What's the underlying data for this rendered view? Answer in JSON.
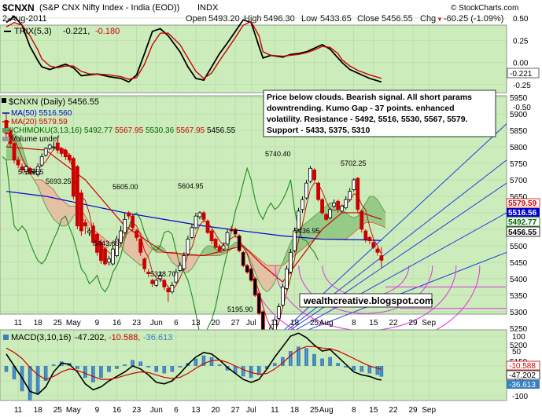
{
  "header": {
    "symbol": "$CNXN",
    "name": "(S&P CNX Nifty Index - India (EOD))",
    "exchange": "INDX",
    "brand": "© StockCharts.com",
    "date": "2-Aug-2011",
    "open_label": "Open",
    "open": "5493.20",
    "high_label": "High",
    "high": "5496.30",
    "low_label": "Low",
    "low": "5433.65",
    "close_label": "Close",
    "close": "5456.55",
    "chg_label": "Chg",
    "chg": "-60.25 (-1.09%)",
    "chg_arrow": "▼"
  },
  "trix_panel": {
    "legend_name": "TRIX(5,3)",
    "legend_v1": "-0.221,",
    "legend_v2": "-0.180",
    "tag": "-0.221",
    "ticks": [
      "0.50",
      "0.25",
      "0.00",
      "-0.25",
      "-0.50"
    ],
    "colors": {
      "trix": "#000000",
      "signal": "#cc0000"
    }
  },
  "price_panel": {
    "legend_symbol": "$CNXN (Daily) 5456.55",
    "legend_ma50": "MA(50) 5516.560",
    "legend_ma20": "MA(20) 5579.59",
    "legend_ichimoku": "ICHIMOKU(3,13,16)",
    "legend_ichimoku_vals": [
      "5492.77",
      "5567.95",
      "5530.36",
      "5567.95",
      "5456.55"
    ],
    "legend_volume": "Volume undef",
    "ticks": [
      "5950",
      "5900",
      "5850",
      "5800",
      "5750",
      "5700",
      "5650",
      "5600",
      "5550",
      "5500",
      "5450",
      "5400",
      "5350",
      "5300",
      "5250",
      "5200",
      "5150"
    ],
    "annotations": [
      "5735.55",
      "5693.25",
      "5605.00",
      "5604.95",
      "5443.65",
      "5328.70",
      "5195.90",
      "5740.40",
      "5702.25",
      "5436.95"
    ],
    "callout": [
      "Price below clouds. Bearish signal. All short params",
      "downtrending. Kumo Gap - 37 points. enhanced",
      "volatility. Resistance - 5492, 5516, 5530, 5567, 5579.",
      "Support - 5433, 5375, 5310"
    ],
    "watermark": "wealthcreative.blogspot.com",
    "tags": [
      "5579.59",
      "5516.56",
      "5492.77",
      "5456.55"
    ]
  },
  "macd_panel": {
    "legend_name": "MACD(3,10,16)",
    "legend_v1": "-47.202,",
    "legend_v2": "-10.588,",
    "legend_v3": "-36.613",
    "ticks": [
      "100",
      "50",
      "0",
      "-50",
      "-100"
    ],
    "tags": [
      "-10.588",
      "-47.202",
      "-36.613"
    ]
  },
  "x_axis": {
    "ticks": [
      "11",
      "18",
      "25",
      "May",
      "9",
      "16",
      "23",
      "Jun",
      "6",
      "13",
      "20",
      "27",
      "Jul",
      "11",
      "18",
      "25",
      "Aug",
      "8",
      "15",
      "22",
      "29",
      "Sep"
    ]
  },
  "chart_data": [
    {
      "type": "line",
      "title": "TRIX(5,3)",
      "ylim": [
        -0.6,
        0.65
      ],
      "series": [
        {
          "name": "TRIX(5,3)",
          "color": "#000000",
          "x": [
            0,
            2,
            4,
            6,
            8,
            9,
            11,
            13,
            15,
            17,
            19,
            21,
            23,
            26,
            29,
            31,
            33,
            35,
            37,
            39,
            41,
            44,
            46,
            48,
            50,
            52,
            54,
            56,
            58,
            60,
            62,
            64,
            65,
            67,
            70,
            72,
            74,
            76,
            78,
            80,
            82,
            84,
            85,
            87,
            89,
            92,
            95
          ],
          "values": [
            0.45,
            0.52,
            0.42,
            0.18,
            0.02,
            -0.05,
            -0.08,
            -0.05,
            -0.02,
            -0.06,
            -0.15,
            -0.14,
            -0.13,
            -0.16,
            -0.18,
            -0.22,
            -0.14,
            0.1,
            0.35,
            0.38,
            0.3,
            0.12,
            -0.05,
            -0.18,
            -0.2,
            -0.05,
            0.1,
            0.22,
            0.35,
            0.48,
            0.45,
            0.18,
            0.05,
            0.08,
            0.06,
            0.09,
            0.1,
            0.12,
            0.16,
            0.2,
            0.15,
            0.05,
            0.0,
            -0.08,
            -0.12,
            -0.18,
            -0.22
          ]
        },
        {
          "name": "signal",
          "color": "#cc0000",
          "x": [
            0,
            2,
            4,
            6,
            8,
            9,
            11,
            13,
            15,
            17,
            19,
            21,
            23,
            26,
            29,
            31,
            33,
            35,
            37,
            39,
            41,
            44,
            46,
            48,
            50,
            52,
            54,
            56,
            58,
            60,
            62,
            64,
            65,
            67,
            70,
            72,
            74,
            76,
            78,
            80,
            82,
            84,
            85,
            87,
            89,
            92,
            95
          ],
          "values": [
            0.4,
            0.45,
            0.42,
            0.3,
            0.14,
            0.04,
            -0.04,
            -0.06,
            -0.04,
            -0.04,
            -0.1,
            -0.13,
            -0.13,
            -0.14,
            -0.16,
            -0.19,
            -0.17,
            -0.02,
            0.2,
            0.33,
            0.33,
            0.2,
            0.05,
            -0.1,
            -0.18,
            -0.12,
            0.02,
            0.15,
            0.28,
            0.42,
            0.46,
            0.3,
            0.12,
            0.08,
            0.07,
            0.08,
            0.09,
            0.11,
            0.14,
            0.18,
            0.17,
            0.1,
            0.03,
            -0.04,
            -0.09,
            -0.14,
            -0.18
          ]
        }
      ]
    },
    {
      "type": "candlestick",
      "title": "$CNXN (Daily)",
      "ylim": [
        5150,
        5990
      ],
      "x": [
        0,
        1,
        2,
        3,
        4,
        5,
        6,
        7,
        8,
        9,
        10,
        11,
        12,
        13,
        14,
        15,
        16,
        17,
        18,
        19,
        20,
        21,
        22,
        23,
        24,
        25,
        26,
        27,
        28,
        29,
        30,
        31,
        32,
        33,
        34,
        35,
        36,
        37,
        38,
        39,
        40,
        41,
        42,
        43,
        44,
        45,
        46,
        47,
        48,
        49,
        50,
        51,
        52,
        53,
        54,
        55,
        56,
        57,
        58,
        59,
        60,
        61,
        62,
        63,
        64,
        65,
        66,
        67,
        68,
        69,
        70,
        71,
        72,
        73,
        74,
        75,
        76,
        77,
        78,
        79,
        80,
        81,
        82,
        83,
        84,
        85,
        86,
        87,
        88,
        89,
        90,
        91,
        92,
        93,
        94,
        95
      ],
      "open": [
        5880,
        5850,
        5810,
        5760,
        5740,
        5725,
        5735,
        5725,
        5715,
        5745,
        5775,
        5795,
        5800,
        5812,
        5795,
        5790,
        5775,
        5765,
        5740,
        5660,
        5570,
        5540,
        5560,
        5535,
        5510,
        5490,
        5450,
        5445,
        5470,
        5510,
        5540,
        5600,
        5590,
        5545,
        5520,
        5460,
        5420,
        5395,
        5380,
        5400,
        5395,
        5370,
        5360,
        5390,
        5425,
        5430,
        5475,
        5525,
        5555,
        5588,
        5600,
        5575,
        5545,
        5520,
        5498,
        5490,
        5505,
        5550,
        5550,
        5530,
        5480,
        5440,
        5430,
        5400,
        5355,
        5300,
        5235,
        5215,
        5245,
        5280,
        5320,
        5370,
        5420,
        5485,
        5550,
        5610,
        5645,
        5695,
        5730,
        5690,
        5640,
        5595,
        5585,
        5620,
        5635,
        5605,
        5615,
        5640,
        5670,
        5705,
        5605,
        5545,
        5525,
        5510,
        5490,
        5470
      ],
      "close": [
        5840,
        5810,
        5760,
        5745,
        5730,
        5740,
        5720,
        5725,
        5740,
        5770,
        5795,
        5805,
        5800,
        5790,
        5780,
        5770,
        5760,
        5650,
        5560,
        5545,
        5560,
        5545,
        5510,
        5480,
        5455,
        5445,
        5460,
        5490,
        5520,
        5545,
        5580,
        5590,
        5555,
        5525,
        5480,
        5430,
        5415,
        5385,
        5395,
        5410,
        5375,
        5360,
        5380,
        5420,
        5440,
        5470,
        5520,
        5555,
        5590,
        5600,
        5580,
        5540,
        5515,
        5495,
        5485,
        5500,
        5540,
        5545,
        5535,
        5485,
        5440,
        5420,
        5395,
        5350,
        5295,
        5230,
        5220,
        5250,
        5275,
        5315,
        5375,
        5430,
        5480,
        5545,
        5605,
        5640,
        5690,
        5735,
        5700,
        5640,
        5600,
        5580,
        5610,
        5630,
        5610,
        5620,
        5640,
        5665,
        5700,
        5610,
        5550,
        5520,
        5515,
        5495,
        5480,
        5456
      ],
      "high": [
        5900,
        5860,
        5815,
        5770,
        5750,
        5745,
        5740,
        5735,
        5750,
        5780,
        5800,
        5810,
        5815,
        5820,
        5800,
        5795,
        5780,
        5770,
        5745,
        5670,
        5580,
        5555,
        5570,
        5540,
        5520,
        5495,
        5470,
        5500,
        5530,
        5560,
        5600,
        5605,
        5595,
        5550,
        5525,
        5465,
        5430,
        5400,
        5400,
        5420,
        5400,
        5378,
        5390,
        5430,
        5450,
        5480,
        5530,
        5565,
        5600,
        5605,
        5605,
        5580,
        5550,
        5525,
        5505,
        5510,
        5550,
        5560,
        5555,
        5535,
        5485,
        5445,
        5435,
        5405,
        5360,
        5305,
        5240,
        5260,
        5285,
        5325,
        5385,
        5440,
        5490,
        5555,
        5615,
        5650,
        5700,
        5742,
        5735,
        5695,
        5645,
        5600,
        5615,
        5640,
        5640,
        5625,
        5650,
        5675,
        5705,
        5708,
        5610,
        5550,
        5530,
        5515,
        5495,
        5496
      ],
      "low": [
        5830,
        5800,
        5750,
        5735,
        5720,
        5715,
        5715,
        5715,
        5710,
        5740,
        5770,
        5790,
        5790,
        5780,
        5770,
        5760,
        5750,
        5640,
        5550,
        5530,
        5535,
        5530,
        5500,
        5470,
        5445,
        5440,
        5440,
        5440,
        5465,
        5505,
        5535,
        5580,
        5545,
        5515,
        5470,
        5420,
        5405,
        5375,
        5375,
        5390,
        5365,
        5330,
        5355,
        5385,
        5420,
        5425,
        5470,
        5520,
        5550,
        5580,
        5570,
        5535,
        5505,
        5490,
        5480,
        5485,
        5500,
        5540,
        5525,
        5480,
        5435,
        5415,
        5390,
        5345,
        5290,
        5228,
        5196,
        5210,
        5240,
        5275,
        5315,
        5365,
        5415,
        5480,
        5545,
        5600,
        5640,
        5690,
        5695,
        5635,
        5595,
        5575,
        5580,
        5615,
        5600,
        5600,
        5610,
        5635,
        5665,
        5600,
        5540,
        5510,
        5505,
        5490,
        5470,
        5434
      ],
      "series": [
        {
          "name": "MA(50)",
          "color": "#0000cc",
          "x": [
            0,
            10,
            20,
            30,
            40,
            50,
            60,
            70,
            80,
            90,
            95
          ],
          "values": [
            5665,
            5650,
            5625,
            5600,
            5580,
            5560,
            5545,
            5530,
            5520,
            5518,
            5516
          ]
        },
        {
          "name": "MA(20)",
          "color": "#cc0000",
          "x": [
            0,
            10,
            20,
            30,
            40,
            50,
            60,
            65,
            70,
            75,
            80,
            85,
            90,
            95
          ],
          "values": [
            5800,
            5790,
            5700,
            5560,
            5480,
            5470,
            5500,
            5440,
            5390,
            5470,
            5550,
            5600,
            5600,
            5580
          ]
        }
      ]
    },
    {
      "type": "bar+line",
      "title": "MACD(3,10,16)",
      "ylim": [
        -140,
        140
      ],
      "x": [
        0,
        2,
        4,
        6,
        8,
        10,
        12,
        14,
        16,
        18,
        20,
        22,
        24,
        26,
        28,
        30,
        32,
        34,
        36,
        38,
        40,
        42,
        44,
        46,
        48,
        50,
        52,
        54,
        56,
        58,
        60,
        62,
        64,
        66,
        68,
        70,
        72,
        74,
        76,
        78,
        80,
        82,
        84,
        86,
        88,
        90,
        92,
        94,
        95
      ],
      "histogram": [
        -20,
        -45,
        -85,
        -115,
        -95,
        -50,
        5,
        15,
        10,
        -10,
        -40,
        -55,
        -40,
        -20,
        -10,
        5,
        20,
        15,
        -5,
        -20,
        -25,
        -20,
        -5,
        10,
        25,
        35,
        30,
        5,
        -15,
        -25,
        -35,
        -40,
        -30,
        -10,
        10,
        30,
        50,
        65,
        60,
        40,
        25,
        30,
        10,
        -5,
        -15,
        -20,
        -25,
        -30,
        -36
      ],
      "series": [
        {
          "name": "MACD",
          "color": "#000000",
          "values": [
            40,
            0,
            -40,
            -85,
            -95,
            -70,
            -20,
            10,
            5,
            -20,
            -60,
            -80,
            -70,
            -50,
            -35,
            -20,
            0,
            -10,
            -30,
            -55,
            -60,
            -50,
            -25,
            5,
            30,
            45,
            40,
            20,
            -5,
            -25,
            -45,
            -55,
            -45,
            -10,
            30,
            65,
            100,
            110,
            95,
            70,
            50,
            55,
            30,
            5,
            -20,
            -30,
            -35,
            -45,
            -47
          ]
        },
        {
          "name": "signal",
          "color": "#cc0000",
          "values": [
            60,
            45,
            25,
            -5,
            -30,
            -45,
            -35,
            -20,
            -10,
            -15,
            -25,
            -35,
            -45,
            -45,
            -40,
            -32,
            -25,
            -20,
            -22,
            -30,
            -38,
            -42,
            -38,
            -25,
            -8,
            8,
            18,
            20,
            12,
            0,
            -12,
            -22,
            -28,
            -25,
            -10,
            10,
            35,
            55,
            65,
            65,
            60,
            58,
            50,
            38,
            25,
            12,
            0,
            -8,
            -11
          ]
        }
      ]
    }
  ]
}
